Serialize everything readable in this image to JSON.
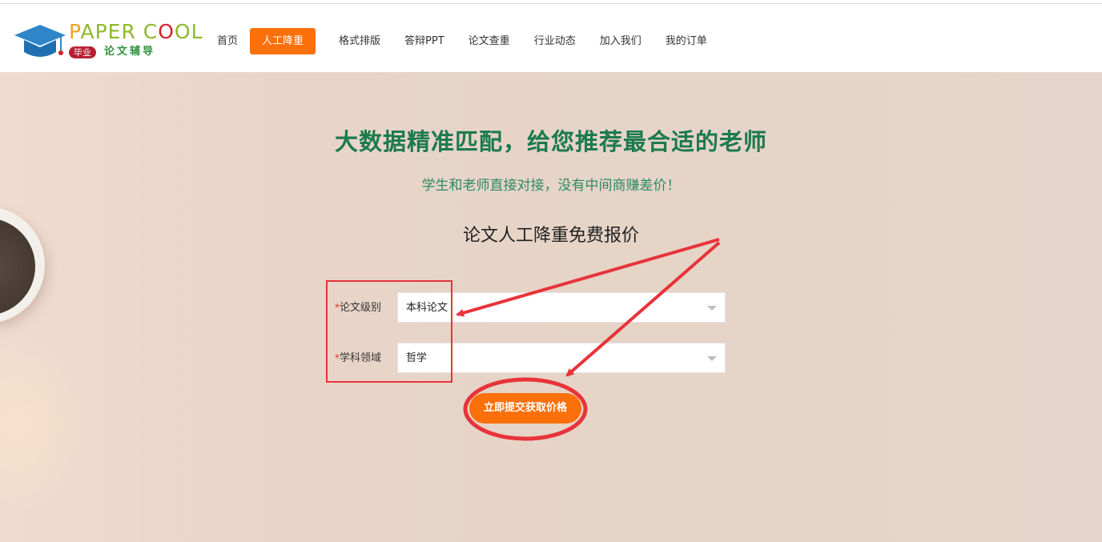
{
  "logo": {
    "brand_part1": "P",
    "brand_part2": "APER C",
    "brand_part3": "O",
    "brand_part4": "OL",
    "tag": "毕业",
    "subtitle": "论文辅导"
  },
  "nav": {
    "items": [
      {
        "label": "首页",
        "active": false
      },
      {
        "label": "人工降重",
        "active": true
      },
      {
        "label": "格式排版",
        "active": false
      },
      {
        "label": "答辩PPT",
        "active": false
      },
      {
        "label": "论文查重",
        "active": false
      },
      {
        "label": "行业动态",
        "active": false
      },
      {
        "label": "加入我们",
        "active": false
      },
      {
        "label": "我的订单",
        "active": false
      }
    ]
  },
  "hero": {
    "title": "大数据精准匹配，给您推荐最合适的老师",
    "subtitle": "学生和老师直接对接，没有中间商赚差价！",
    "form_title": "论文人工降重免费报价"
  },
  "form": {
    "level_required": "*",
    "level_label": "论文级别",
    "level_value": "本科论文",
    "field_required": "*",
    "field_label": "学科领域",
    "field_value": "哲学",
    "submit_label": "立即提交获取价格"
  },
  "colors": {
    "accent": "#fb700b",
    "title_green": "#1c7a4e",
    "annotation_red": "#e8333a"
  }
}
